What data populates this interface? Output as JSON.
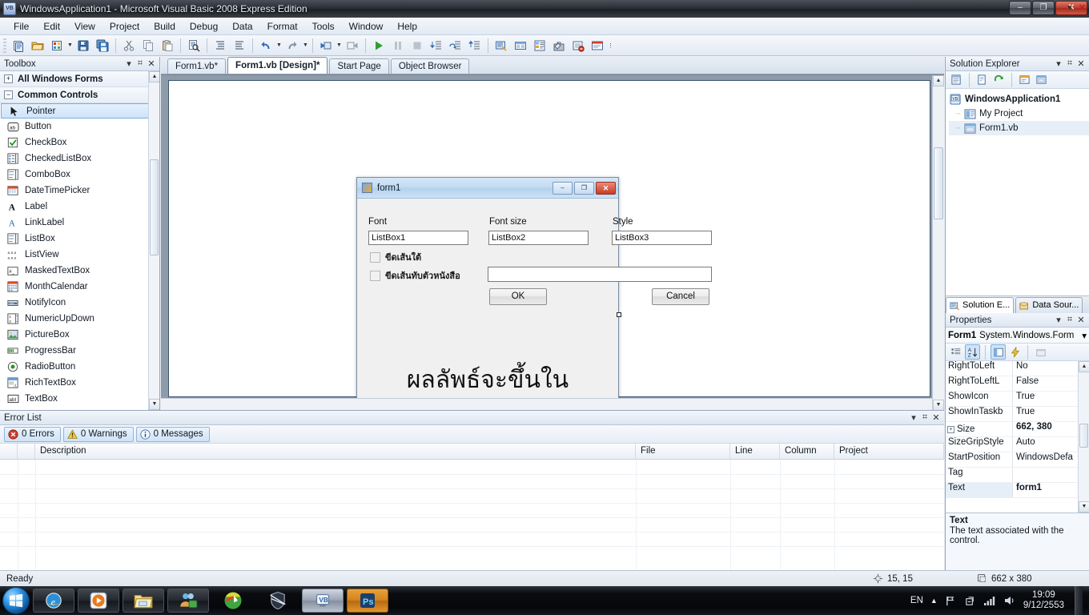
{
  "window": {
    "title": "WindowsApplication1 - Microsoft Visual Basic 2008 Express Edition",
    "app_icon": "visual-basic-icon",
    "minimize": "–",
    "restore": "❐",
    "close": "✕"
  },
  "menubar": {
    "items": [
      "File",
      "Edit",
      "View",
      "Project",
      "Build",
      "Debug",
      "Data",
      "Format",
      "Tools",
      "Window",
      "Help"
    ]
  },
  "toolbar": {
    "buttons": [
      {
        "name": "new-project-icon",
        "tip": "New Project"
      },
      {
        "name": "open-file-icon",
        "tip": "Open File"
      },
      {
        "name": "add-new-item-icon",
        "tip": "Add New Item"
      },
      {
        "name": "save-icon",
        "tip": "Save"
      },
      {
        "name": "save-all-icon",
        "tip": "Save All"
      },
      {
        "name": "cut-icon",
        "tip": "Cut"
      },
      {
        "name": "copy-icon",
        "tip": "Copy"
      },
      {
        "name": "paste-icon",
        "tip": "Paste"
      },
      {
        "name": "find-icon",
        "tip": "Find"
      },
      {
        "name": "comment-icon",
        "tip": "Comment"
      },
      {
        "name": "uncomment-icon",
        "tip": "Uncomment"
      },
      {
        "name": "undo-icon",
        "tip": "Undo"
      },
      {
        "name": "redo-icon",
        "tip": "Redo"
      },
      {
        "name": "navigate-backward-icon",
        "tip": "Navigate Backward"
      },
      {
        "name": "navigate-forward-icon",
        "tip": "Navigate Forward"
      },
      {
        "name": "start-debugging-icon",
        "tip": "Start Debugging"
      },
      {
        "name": "pause-icon",
        "tip": "Break All"
      },
      {
        "name": "stop-icon",
        "tip": "Stop Debugging"
      },
      {
        "name": "step-into-icon",
        "tip": "Step Into"
      },
      {
        "name": "step-over-icon",
        "tip": "Step Over"
      },
      {
        "name": "step-out-icon",
        "tip": "Step Out"
      },
      {
        "name": "solution-explorer-icon",
        "tip": "Solution Explorer"
      },
      {
        "name": "properties-window-icon",
        "tip": "Properties Window"
      },
      {
        "name": "object-browser-icon",
        "tip": "Object Browser"
      },
      {
        "name": "toolbox-icon",
        "tip": "Toolbox"
      },
      {
        "name": "error-list-icon",
        "tip": "Error List"
      },
      {
        "name": "immediate-window-icon",
        "tip": "Immediate Window"
      }
    ]
  },
  "toolbox": {
    "title": "Toolbox",
    "groups": [
      {
        "label": "All Windows Forms",
        "expander": "+"
      },
      {
        "label": "Common Controls",
        "expander": "−"
      }
    ],
    "items": [
      {
        "label": "Pointer",
        "icon": "pointer-icon",
        "selected": true
      },
      {
        "label": "Button",
        "icon": "button-icon",
        "selected": false
      },
      {
        "label": "CheckBox",
        "icon": "checkbox-icon",
        "selected": false
      },
      {
        "label": "CheckedListBox",
        "icon": "checkedlistbox-icon",
        "selected": false
      },
      {
        "label": "ComboBox",
        "icon": "combobox-icon",
        "selected": false
      },
      {
        "label": "DateTimePicker",
        "icon": "datetimepicker-icon",
        "selected": false
      },
      {
        "label": "Label",
        "icon": "label-icon",
        "selected": false
      },
      {
        "label": "LinkLabel",
        "icon": "linklabel-icon",
        "selected": false
      },
      {
        "label": "ListBox",
        "icon": "listbox-icon",
        "selected": false
      },
      {
        "label": "ListView",
        "icon": "listview-icon",
        "selected": false
      },
      {
        "label": "MaskedTextBox",
        "icon": "maskedtextbox-icon",
        "selected": false
      },
      {
        "label": "MonthCalendar",
        "icon": "monthcalendar-icon",
        "selected": false
      },
      {
        "label": "NotifyIcon",
        "icon": "notifyicon-icon",
        "selected": false
      },
      {
        "label": "NumericUpDown",
        "icon": "numericupdown-icon",
        "selected": false
      },
      {
        "label": "PictureBox",
        "icon": "picturebox-icon",
        "selected": false
      },
      {
        "label": "ProgressBar",
        "icon": "progressbar-icon",
        "selected": false
      },
      {
        "label": "RadioButton",
        "icon": "radiobutton-icon",
        "selected": false
      },
      {
        "label": "RichTextBox",
        "icon": "richtextbox-icon",
        "selected": false
      },
      {
        "label": "TextBox",
        "icon": "textbox-icon",
        "selected": false
      }
    ]
  },
  "doctabs": {
    "tabs": [
      {
        "label": "Form1.vb*",
        "active": false
      },
      {
        "label": "Form1.vb [Design]*",
        "active": true
      },
      {
        "label": "Start Page",
        "active": false
      },
      {
        "label": "Object Browser",
        "active": false
      }
    ]
  },
  "form_designer": {
    "form_title": "form1",
    "minimize": "–",
    "maximize": "❐",
    "close": "✕",
    "labels": {
      "font": "Font",
      "font_size": "Font size",
      "style": "Style"
    },
    "listboxes": [
      "ListBox1",
      "ListBox2",
      "ListBox3"
    ],
    "checkboxes": [
      {
        "label": "ขีดเส้นใต้",
        "checked": false
      },
      {
        "label": "ขีดเส้นทับตัวหนังสือ",
        "checked": false
      }
    ],
    "textbox_value": "",
    "buttons": {
      "ok": "OK",
      "cancel": "Cancel"
    },
    "big_text": "ผลลัพธ์จะขึ้นใน TextBox"
  },
  "solution_explorer": {
    "title": "Solution Explorer",
    "toolbar": [
      {
        "name": "properties-icon"
      },
      {
        "name": "show-all-files-icon"
      },
      {
        "name": "refresh-icon"
      },
      {
        "name": "view-code-icon"
      },
      {
        "name": "view-designer-icon"
      }
    ],
    "tree": [
      {
        "label": "WindowsApplication1",
        "icon": "project-icon",
        "level": 0
      },
      {
        "label": "My Project",
        "icon": "my-project-icon",
        "level": 1
      },
      {
        "label": "Form1.vb",
        "icon": "form-file-icon",
        "level": 1
      }
    ],
    "tabs": [
      {
        "label": "Solution E...",
        "icon": "solution-explorer-icon",
        "active": true
      },
      {
        "label": "Data Sour...",
        "icon": "data-sources-icon",
        "active": false
      }
    ]
  },
  "properties": {
    "title": "Properties",
    "object_name": "Form1",
    "object_type": "System.Windows.Form",
    "toolbar": [
      {
        "name": "categorized-icon",
        "active": false
      },
      {
        "name": "alphabetical-icon",
        "active": true
      },
      {
        "name": "properties-view-icon",
        "active": true
      },
      {
        "name": "events-view-icon",
        "active": false
      },
      {
        "name": "property-pages-icon",
        "active": false
      }
    ],
    "rows": [
      {
        "name": "RightToLeft",
        "value": "No",
        "bold": false,
        "expandable": false,
        "selected": false
      },
      {
        "name": "RightToLeftL",
        "value": "False",
        "bold": false,
        "expandable": false,
        "selected": false
      },
      {
        "name": "ShowIcon",
        "value": "True",
        "bold": false,
        "expandable": false,
        "selected": false
      },
      {
        "name": "ShowInTaskb",
        "value": "True",
        "bold": false,
        "expandable": false,
        "selected": false
      },
      {
        "name": "Size",
        "value": "662, 380",
        "bold": true,
        "expandable": true,
        "selected": false
      },
      {
        "name": "SizeGripStyle",
        "value": "Auto",
        "bold": false,
        "expandable": false,
        "selected": false
      },
      {
        "name": "StartPosition",
        "value": "WindowsDefa",
        "bold": false,
        "expandable": false,
        "selected": false
      },
      {
        "name": "Tag",
        "value": "",
        "bold": false,
        "expandable": false,
        "selected": false
      },
      {
        "name": "Text",
        "value": "form1",
        "bold": true,
        "expandable": false,
        "selected": true
      }
    ],
    "description_title": "Text",
    "description_body": "The text associated with the control."
  },
  "error_list": {
    "title": "Error List",
    "chips": [
      {
        "label": "0 Errors",
        "icon": "error-icon"
      },
      {
        "label": "0 Warnings",
        "icon": "warning-icon"
      },
      {
        "label": "0 Messages",
        "icon": "info-icon"
      }
    ],
    "columns": [
      "",
      "",
      "Description",
      "File",
      "Line",
      "Column",
      "Project"
    ]
  },
  "statusbar": {
    "status": "Ready",
    "cursor_position": "15, 15",
    "size": "662 x 380",
    "position_icon": "position-icon",
    "size_icon": "size-icon"
  },
  "taskbar": {
    "start": "start-orb-icon",
    "apps": [
      {
        "name": "internet-explorer-icon",
        "state": "normal"
      },
      {
        "name": "windows-media-player-icon",
        "state": "normal"
      },
      {
        "name": "windows-explorer-icon",
        "state": "normal"
      },
      {
        "name": "msn-messenger-icon",
        "state": "normal"
      },
      {
        "name": "internet-download-manager-icon",
        "state": "plain"
      },
      {
        "name": "antivirus-icon",
        "state": "plain"
      },
      {
        "name": "visual-basic-icon",
        "state": "running"
      },
      {
        "name": "photoshop-icon",
        "state": "active"
      }
    ],
    "tray": {
      "language": "EN",
      "show_hidden_icon": "chevron-up-icon",
      "network_flag_icon": "network-icon",
      "action_center_icon": "action-center-icon",
      "signal_icon": "signal-icon",
      "volume_icon": "volume-icon",
      "time": "19:09",
      "date": "9/12/2553"
    }
  }
}
